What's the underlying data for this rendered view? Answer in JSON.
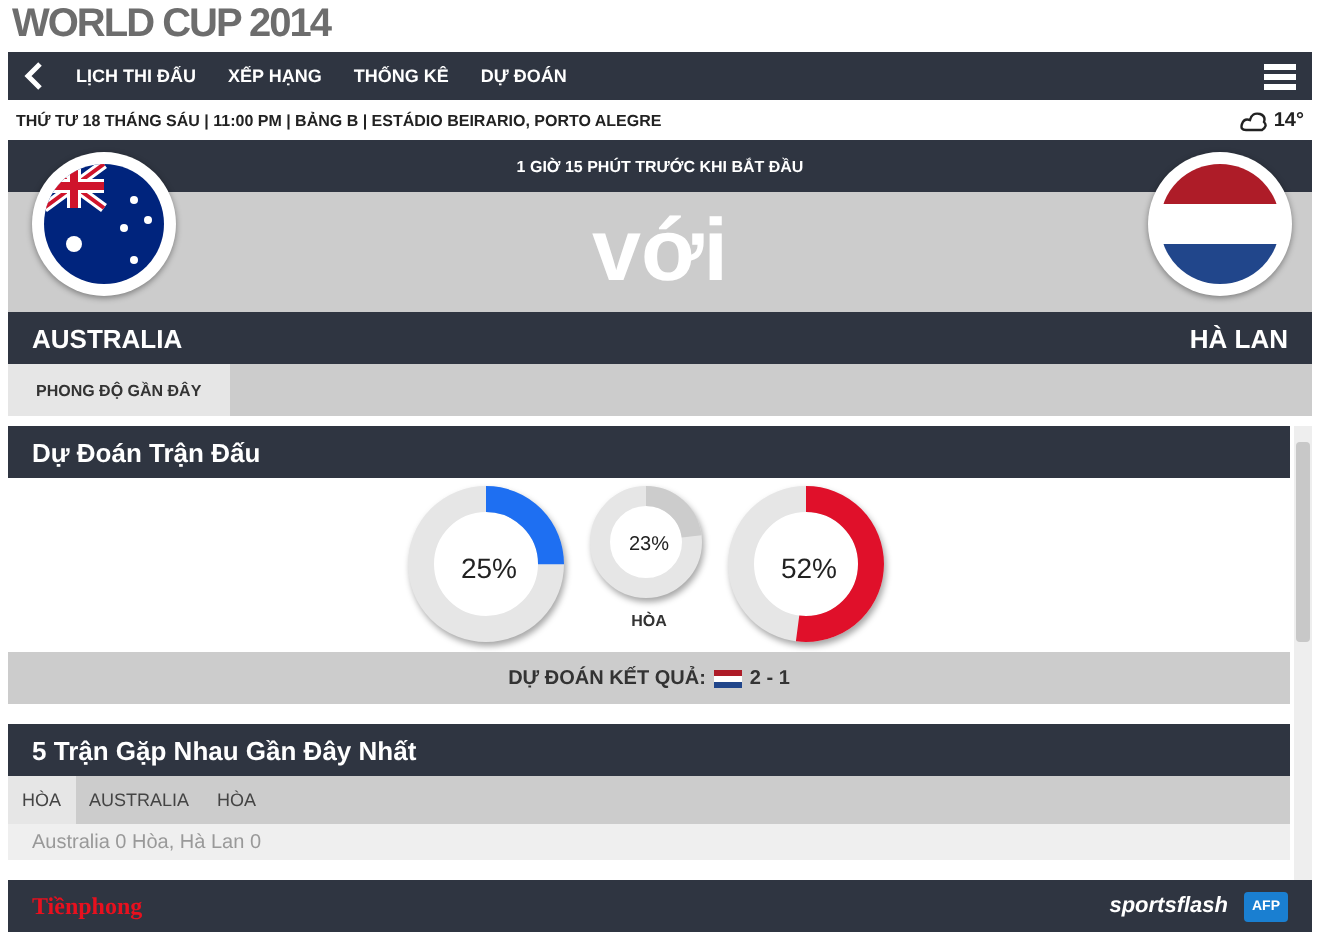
{
  "title": "WORLD CUP 2014",
  "nav": {
    "items": [
      {
        "label": "LỊCH THI ĐẤU",
        "selected": false
      },
      {
        "label": "XẾP HẠNG",
        "selected": false
      },
      {
        "label": "THỐNG KÊ",
        "selected": false
      },
      {
        "label": "DỰ ĐOÁN",
        "selected": false
      }
    ]
  },
  "match_info": "THỨ TƯ 18 THÁNG SÁU | 11:00 PM | BẢNG B | ESTÁDIO BEIRARIO, PORTO ALEGRE",
  "weather": "14°",
  "countdown": "1 GIỜ 15 PHÚT TRƯỚC KHI BẮT ĐẦU",
  "versus": "với",
  "home_team": "AUSTRALIA",
  "away_team": "HÀ LAN",
  "match_tabs": [
    {
      "label": "PHONG ĐỘ GẦN ĐÂY",
      "selected": true
    }
  ],
  "prediction": {
    "title": "Dự Đoán Trận Đấu",
    "donuts": [
      {
        "reading": "25%",
        "color": "#1e6ff2",
        "kind": "team"
      },
      {
        "reading": "23%",
        "color": "#cccccc",
        "kind": "draw",
        "caption": "HÒA"
      },
      {
        "reading": "52%",
        "color": "#e0102a",
        "kind": "team"
      }
    ],
    "result_label": "DỰ ĐOÁN KẾT QUẢ:",
    "result_score": "2 - 1"
  },
  "head_to_head": {
    "title": "5 Trận Gặp Nhau Gần Đây Nhất",
    "tabs": [
      {
        "label": "HÒA",
        "selected": true
      },
      {
        "label": "AUSTRALIA",
        "selected": false
      },
      {
        "label": "HÒA",
        "selected": false
      }
    ],
    "row": "Australia 0 Hòa, Hà Lan 0"
  },
  "footer": {
    "left_logo": "Tiềnphong",
    "right_logo": "sportsflash",
    "badge": "AFP"
  }
}
